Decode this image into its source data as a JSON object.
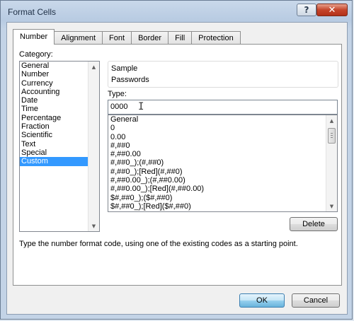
{
  "window": {
    "title": "Format Cells",
    "help_label": "?",
    "close_label": "✕"
  },
  "tabs": [
    {
      "label": "Number",
      "active": true
    },
    {
      "label": "Alignment",
      "active": false
    },
    {
      "label": "Font",
      "active": false
    },
    {
      "label": "Border",
      "active": false
    },
    {
      "label": "Fill",
      "active": false
    },
    {
      "label": "Protection",
      "active": false
    }
  ],
  "category": {
    "label": "Category:",
    "items": [
      "General",
      "Number",
      "Currency",
      "Accounting",
      "Date",
      "Time",
      "Percentage",
      "Fraction",
      "Scientific",
      "Text",
      "Special",
      "Custom"
    ],
    "selected": "Custom"
  },
  "sample": {
    "label": "Sample",
    "value": "Passwords"
  },
  "type": {
    "label": "Type:",
    "value": "0000",
    "formats": [
      "General",
      "0",
      "0.00",
      "#,##0",
      "#,##0.00",
      "#,##0_);(#,##0)",
      "#,##0_);[Red](#,##0)",
      "#,##0.00_);(#,##0.00)",
      "#,##0.00_);[Red](#,##0.00)",
      "$#,##0_);($#,##0)",
      "$#,##0_);[Red]($#,##0)"
    ]
  },
  "buttons": {
    "delete": "Delete",
    "ok": "OK",
    "cancel": "Cancel"
  },
  "hint": "Type the number format code, using one of the existing codes as a starting point."
}
